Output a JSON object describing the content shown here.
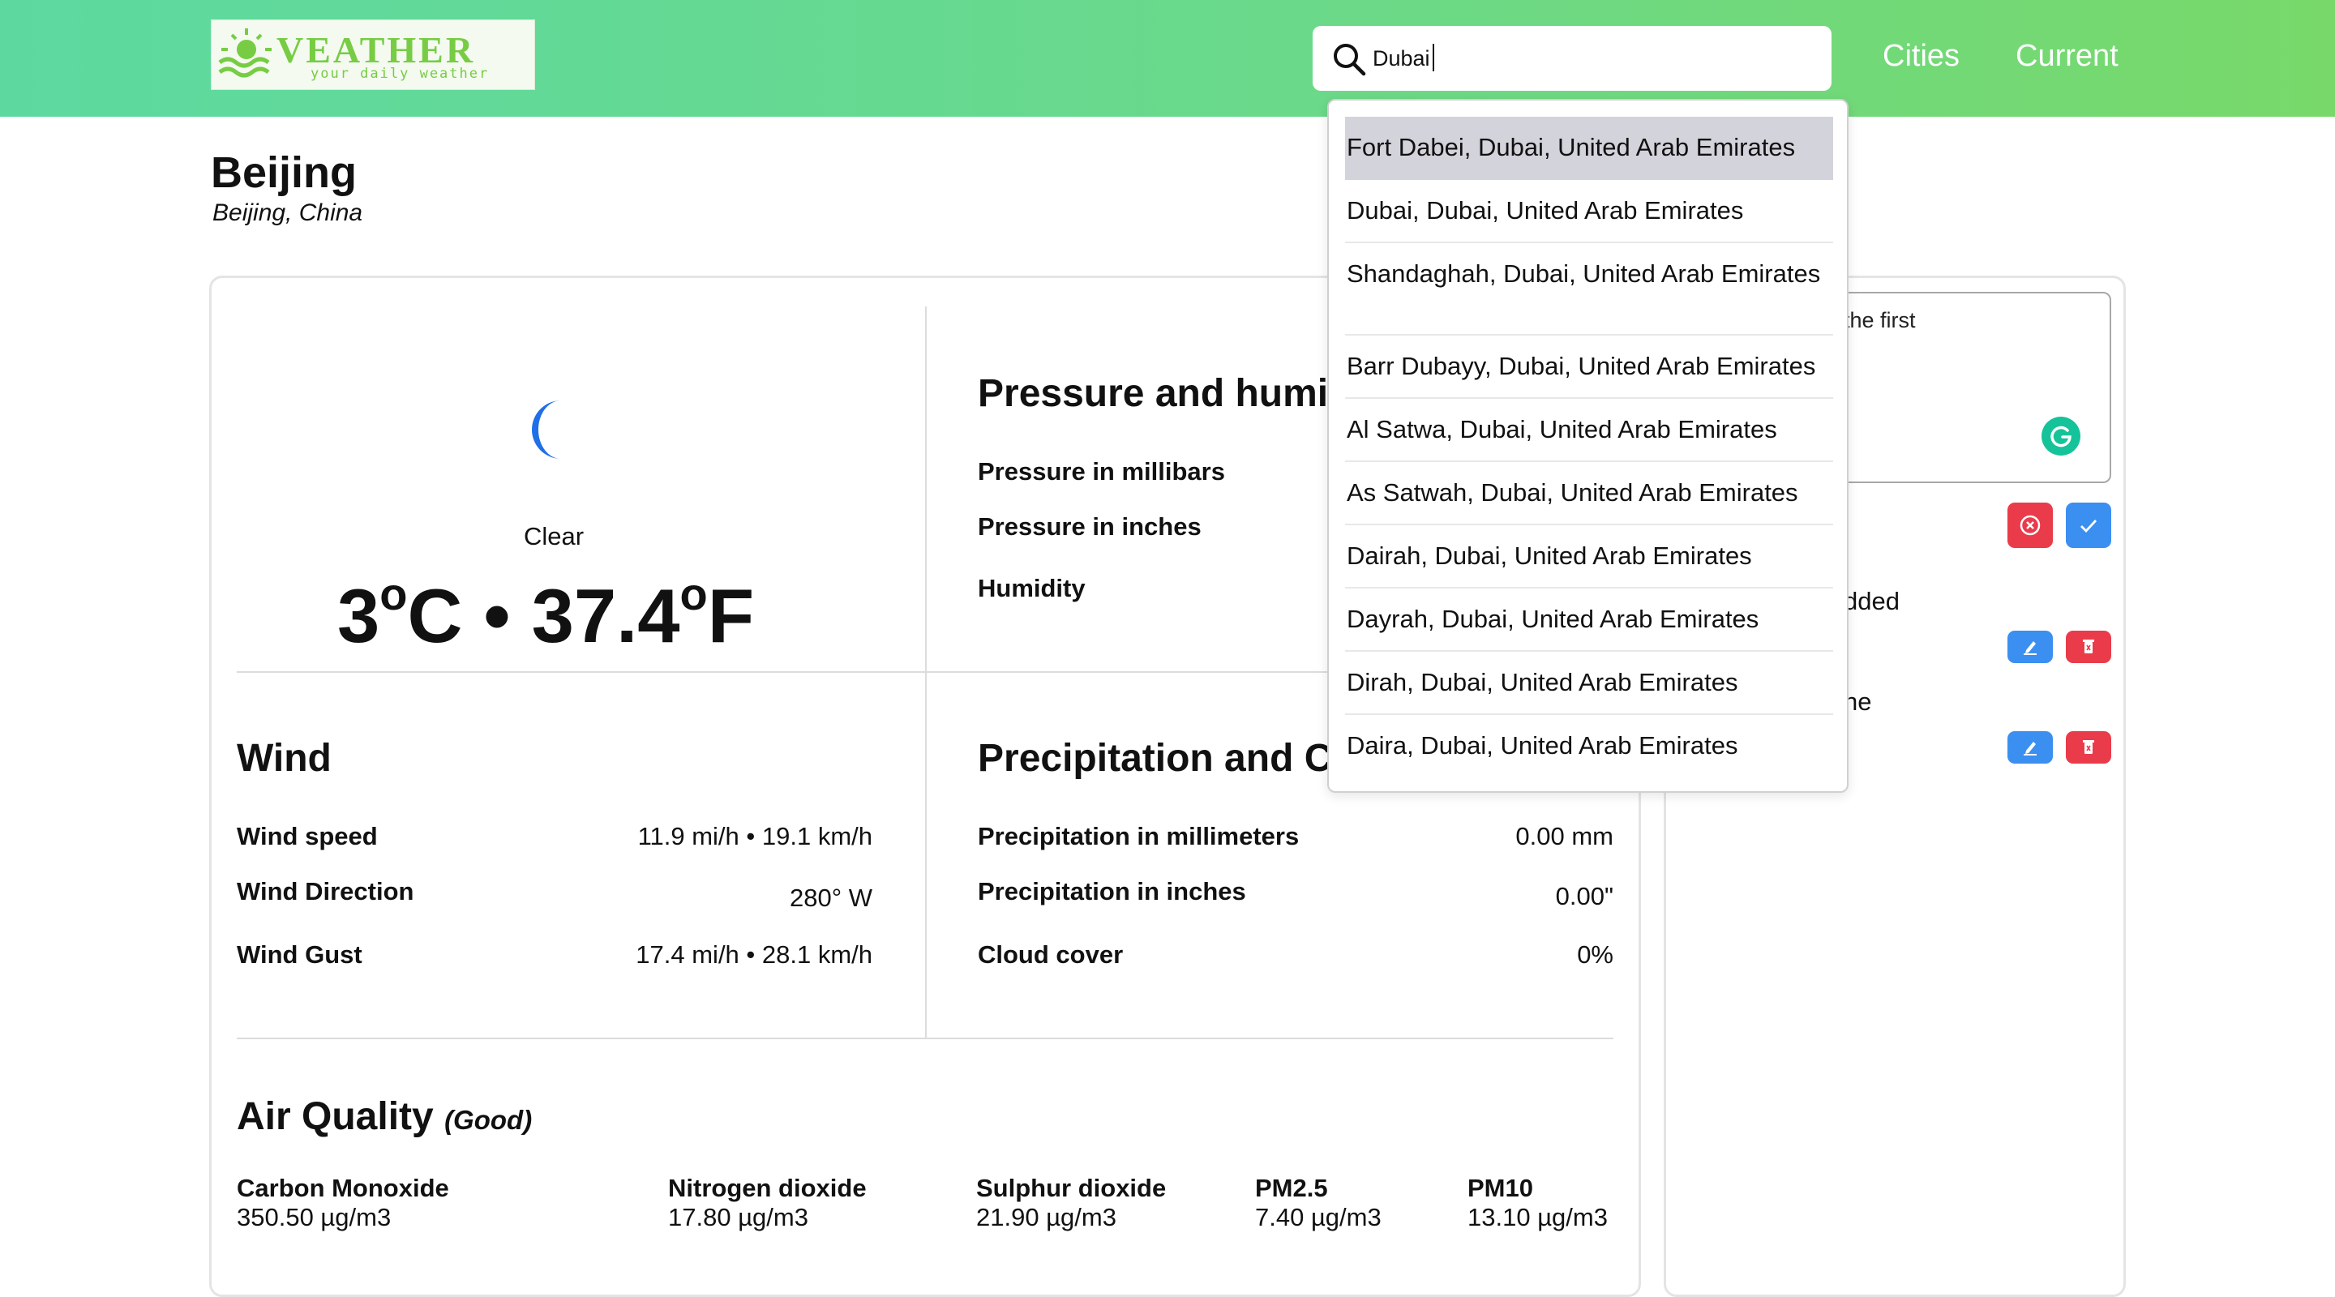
{
  "header": {
    "logo": {
      "word": "VEATHER",
      "tagline": "your daily weather"
    },
    "search": {
      "value": "Dubai"
    },
    "nav": {
      "cities": "Cities",
      "current": "Current"
    }
  },
  "location": {
    "city": "Beijing",
    "region": "Beijing, China"
  },
  "current": {
    "condition": "Clear",
    "temp_c": "3",
    "temp_f": "37.4",
    "unit_c": "C",
    "unit_f": "F",
    "degree_mark": "o",
    "separator": "•"
  },
  "pressure": {
    "title": "Pressure and humi",
    "rows": [
      {
        "label": "Pressure in millibars"
      },
      {
        "label": "Pressure in inches"
      },
      {
        "label": "Humidity"
      }
    ]
  },
  "wind": {
    "title": "Wind",
    "rows": [
      {
        "label": "Wind speed",
        "value": "11.9 mi/h • 19.1 km/h"
      },
      {
        "label": "Wind Direction",
        "value": "280° W"
      },
      {
        "label": "Wind Gust",
        "value": "17.4 mi/h • 28.1 km/h"
      }
    ]
  },
  "precipitation": {
    "title": "Precipitation and C",
    "rows": [
      {
        "label": "Precipitation in millimeters",
        "value": "0.00 mm"
      },
      {
        "label": "Precipitation in inches",
        "value": "0.00\""
      },
      {
        "label": "Cloud cover",
        "value": "0%"
      }
    ]
  },
  "air_quality": {
    "title": "Air Quality",
    "status": "(Good)",
    "items": [
      {
        "label": "Carbon Monoxide",
        "value": "350.50 µg/m3"
      },
      {
        "label": "Nitrogen dioxide",
        "value": "17.80 µg/m3"
      },
      {
        "label": "Sulphur dioxide",
        "value": "21.90 µg/m3"
      },
      {
        "label": "PM2.5",
        "value": "7.40 µg/m3"
      },
      {
        "label": "PM10",
        "value": "13.10 µg/m3"
      }
    ]
  },
  "notes": {
    "input_text": "the first",
    "note_1": "dded",
    "note_2": "ne"
  },
  "suggestions": [
    "Fort Dabei, Dubai, United Arab Emirates",
    "Dubai, Dubai, United Arab Emirates",
    "Shandaghah, Dubai, United Arab Emirates",
    "Barr Dubayy, Dubai, United Arab Emirates",
    "Al Satwa, Dubai, United Arab Emirates",
    "As Satwah, Dubai, United Arab Emirates",
    "Dairah, Dubai, United Arab Emirates",
    "Dayrah, Dubai, United Arab Emirates",
    "Dirah, Dubai, United Arab Emirates",
    "Daira, Dubai, United Arab Emirates"
  ],
  "colors": {
    "header_gradient_start": "#5dd9a0",
    "header_gradient_end": "#78d96a",
    "moon": "#1f6fe8",
    "danger": "#ea3b4b",
    "primary": "#3b8ff0",
    "grammarly": "#15c39a"
  }
}
